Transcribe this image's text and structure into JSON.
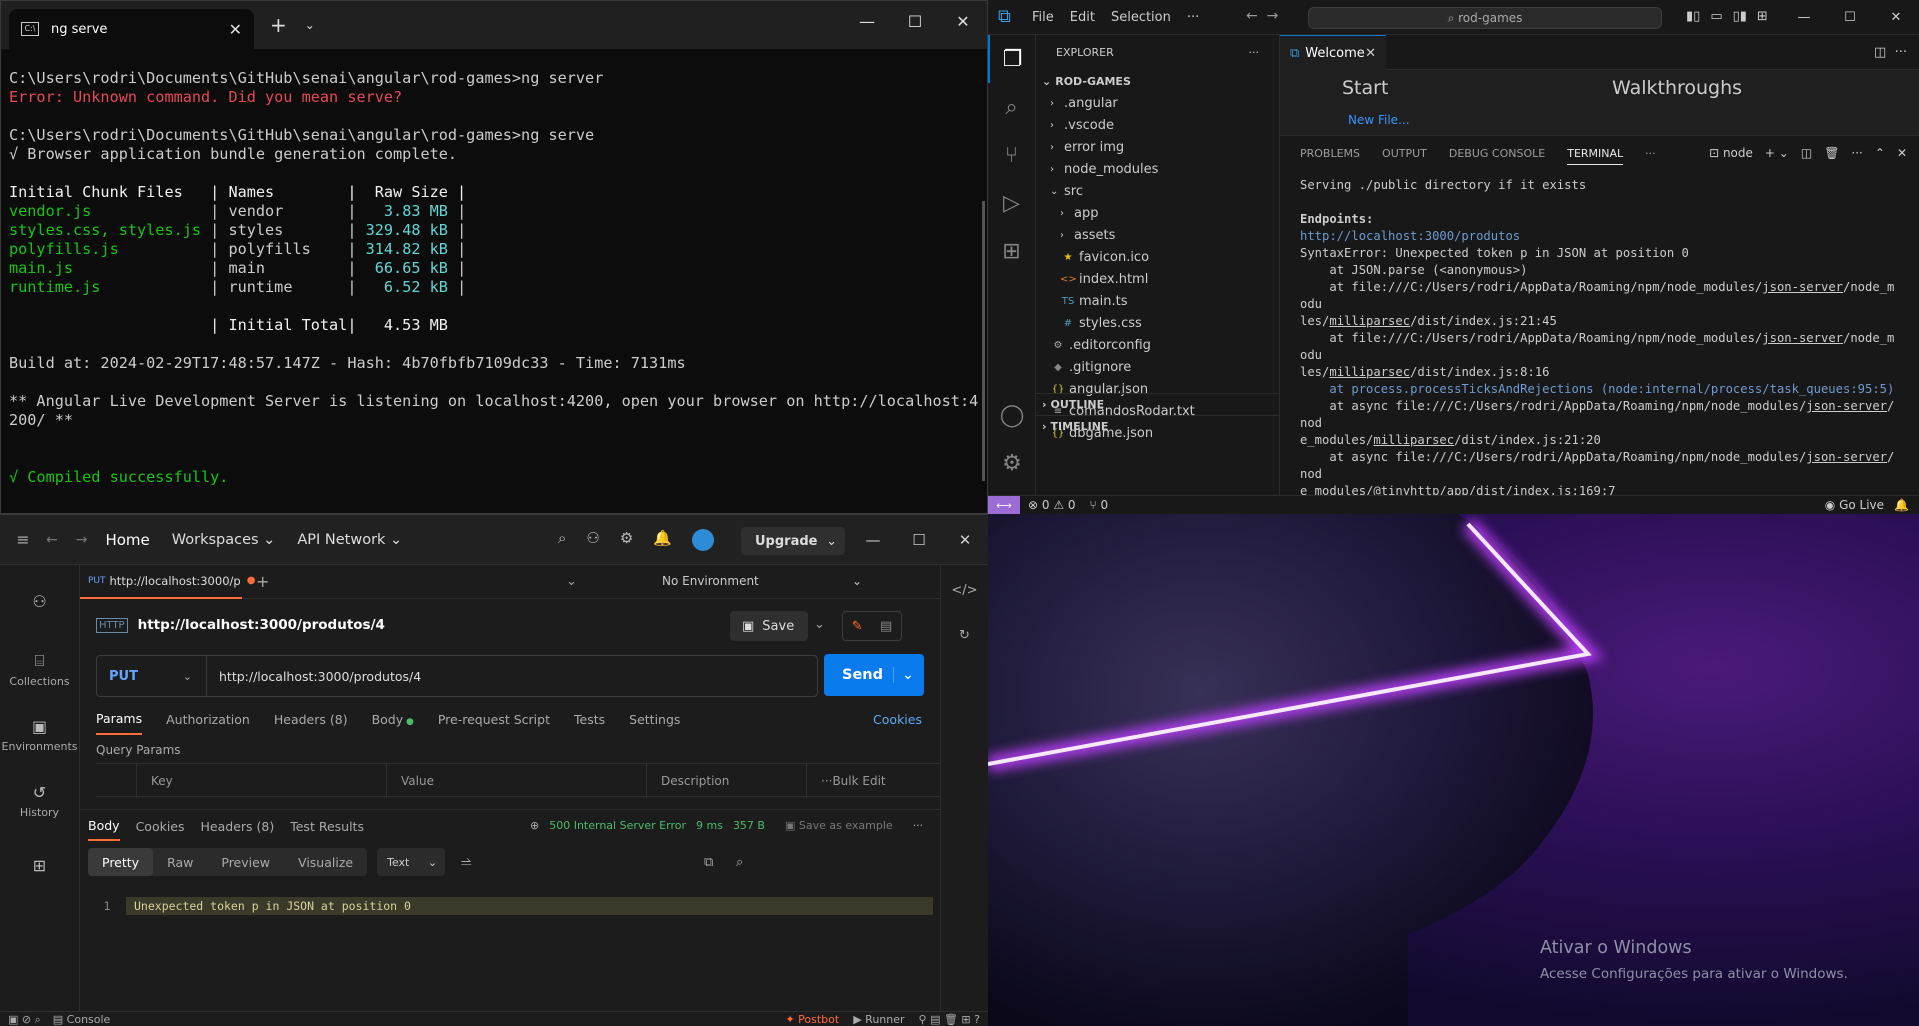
{
  "terminal": {
    "tab_title": "ng serve",
    "lines": [
      {
        "t": "C:\\Users\\rodri\\Documents\\GitHub\\senai\\angular\\rod-games>ng server",
        "c": ""
      },
      {
        "t": "Error: Unknown command. Did you mean serve?",
        "c": "red"
      },
      {
        "t": "",
        "c": ""
      },
      {
        "t": "C:\\Users\\rodri\\Documents\\GitHub\\senai\\angular\\rod-games>ng serve",
        "c": ""
      },
      {
        "t": "√ Browser application bundle generation complete.",
        "c": ""
      },
      {
        "t": "",
        "c": ""
      }
    ],
    "table_header": [
      "Initial Chunk Files",
      "Names",
      "Raw Size"
    ],
    "chunks": [
      {
        "file": "vendor.js",
        "name": "vendor",
        "size": "3.83 MB"
      },
      {
        "file": "styles.css, styles.js",
        "name": "styles",
        "size": "329.48 kB"
      },
      {
        "file": "polyfills.js",
        "name": "polyfills",
        "size": "314.82 kB"
      },
      {
        "file": "main.js",
        "name": "main",
        "size": "66.65 kB"
      },
      {
        "file": "runtime.js",
        "name": "runtime",
        "size": "6.52 kB"
      }
    ],
    "total_label": "Initial Total",
    "total_size": "4.53 MB",
    "build_line": "Build at: 2024-02-29T17:48:57.147Z - Hash: 4b70fbfb7109dc33 - Time: 7131ms",
    "live_line": "** Angular Live Development Server is listening on localhost:4200, open your browser on http://localhost:4\n200/ **",
    "compiled_line": "√ Compiled successfully."
  },
  "vscode": {
    "menu": [
      "File",
      "Edit",
      "Selection",
      "···"
    ],
    "search": "rod-games",
    "explorer_title": "EXPLORER",
    "project": "ROD-GAMES",
    "tree": [
      {
        "label": ".angular",
        "type": "folder",
        "depth": 1
      },
      {
        "label": ".vscode",
        "type": "folder",
        "depth": 1
      },
      {
        "label": "error img",
        "type": "folder",
        "depth": 1
      },
      {
        "label": "node_modules",
        "type": "folder",
        "depth": 1
      },
      {
        "label": "src",
        "type": "open",
        "depth": 1
      },
      {
        "label": "app",
        "type": "folder",
        "depth": 2
      },
      {
        "label": "assets",
        "type": "folder",
        "depth": 2
      },
      {
        "label": "favicon.ico",
        "type": "star",
        "depth": 2
      },
      {
        "label": "index.html",
        "type": "html",
        "depth": 2
      },
      {
        "label": "main.ts",
        "type": "ts",
        "depth": 2
      },
      {
        "label": "styles.css",
        "type": "css",
        "depth": 2
      },
      {
        "label": ".editorconfig",
        "type": "gear",
        "depth": 1
      },
      {
        "label": ".gitignore",
        "type": "git",
        "depth": 1
      },
      {
        "label": "angular.json",
        "type": "json",
        "depth": 1
      },
      {
        "label": "comandosRodar.txt",
        "type": "txt",
        "depth": 1
      },
      {
        "label": "dbgame.json",
        "type": "json",
        "depth": 1
      }
    ],
    "outline": "OUTLINE",
    "timeline": "TIMELINE",
    "editor_tab": "Welcome",
    "welcome_start": "Start",
    "welcome_walk": "Walkthroughs",
    "new_file": "New File...",
    "panel_tabs": [
      "PROBLEMS",
      "OUTPUT",
      "DEBUG CONSOLE",
      "TERMINAL"
    ],
    "terminal_name": "node",
    "status_errors": "⊗ 0 ⚠ 0",
    "status_ports": "⑂ 0",
    "go_live": "Go Live"
  },
  "postman": {
    "nav_home": "Home",
    "nav_workspaces": "Workspaces",
    "nav_api": "API Network",
    "upgrade": "Upgrade",
    "left_items": [
      {
        "icon": "collections-icon",
        "label": "Collections"
      },
      {
        "icon": "environments-icon",
        "label": "Environments"
      },
      {
        "icon": "history-icon",
        "label": "History"
      }
    ],
    "tab_method": "PUT",
    "tab_url": "http://localhost:3000/p",
    "environment": "No Environment",
    "request_name": "http://localhost:3000/produtos/4",
    "save": "Save",
    "method": "PUT",
    "url": "http://localhost:3000/produtos/4",
    "send": "Send",
    "options": [
      "Params",
      "Authorization",
      "Headers (8)",
      "Body",
      "Pre-request Script",
      "Tests",
      "Settings"
    ],
    "cookies": "Cookies",
    "query_params": "Query Params",
    "qcols": [
      "Key",
      "Value",
      "Description",
      "Bulk Edit"
    ],
    "resp_tabs": [
      "Body",
      "Cookies",
      "Headers (8)",
      "Test Results"
    ],
    "status": "500 Internal Server Error",
    "time": "9 ms",
    "size": "357 B",
    "save_example": "Save as example",
    "formats": [
      "Pretty",
      "Raw",
      "Preview",
      "Visualize"
    ],
    "text_type": "Text",
    "line_no": "1",
    "response_body": "Unexpected token p in JSON at position 0",
    "footer_console": "Console",
    "footer_postbot": "Postbot",
    "footer_runner": "Runner"
  },
  "desktop": {
    "activate_title": "Ativar o Windows",
    "activate_sub": "Acesse Configurações para ativar o Windows."
  }
}
